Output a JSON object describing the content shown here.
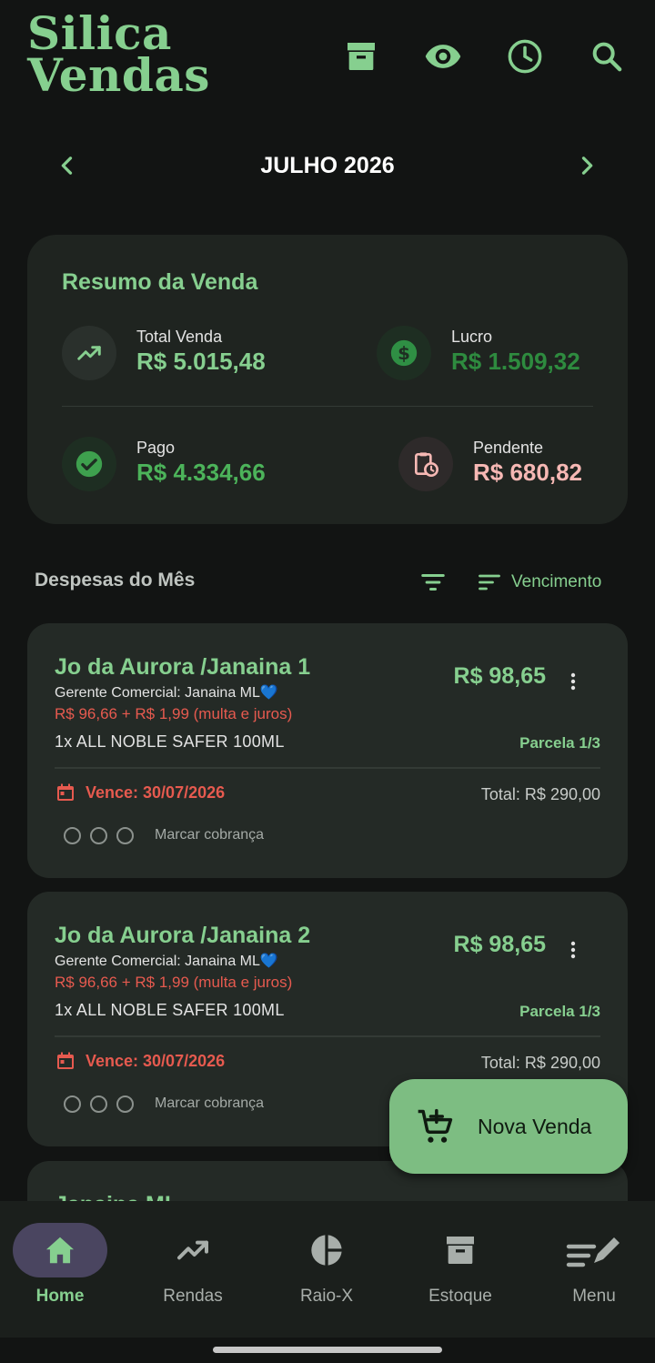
{
  "app": {
    "logo_line1": "Silica",
    "logo_line2": "Vendas"
  },
  "header_icons": [
    "archive-icon",
    "eye-icon",
    "clock-icon",
    "search-icon"
  ],
  "month": {
    "title": "JULHO 2026"
  },
  "summary": {
    "title": "Resumo da Venda",
    "total_venda_label": "Total Venda",
    "total_venda_value": "R$ 5.015,48",
    "lucro_label": "Lucro",
    "lucro_value": "R$ 1.509,32",
    "pago_label": "Pago",
    "pago_value": "R$ 4.334,66",
    "pendente_label": "Pendente",
    "pendente_value": "R$ 680,82"
  },
  "section": {
    "title": "Despesas do Mês",
    "sort_label": "Vencimento"
  },
  "cards": [
    {
      "title": "Jo da Aurora /Janaina 1",
      "sub": "Gerente Comercial: Janaina ML💙",
      "fine": "R$ 96,66 + R$ 1,99 (multa e juros)",
      "item": "1x ALL NOBLE SAFER 100ML",
      "price": "R$ 98,65",
      "parcela": "Parcela 1/3",
      "due": "Vence: 30/07/2026",
      "total": "Total: R$ 290,00",
      "mark": "Marcar cobrança"
    },
    {
      "title": "Jo da Aurora /Janaina 2",
      "sub": "Gerente Comercial: Janaina ML💙",
      "fine": "R$ 96,66 + R$ 1,99 (multa e juros)",
      "item": "1x ALL NOBLE SAFER 100ML",
      "price": "R$ 98,65",
      "parcela": "Parcela 1/3",
      "due": "Vence: 30/07/2026",
      "total": "Total: R$ 290,00",
      "mark": "Marcar cobrança"
    },
    {
      "title": "Janaina ML"
    }
  ],
  "fab": {
    "label": "Nova Venda"
  },
  "nav": [
    {
      "label": "Home",
      "icon": "home-icon"
    },
    {
      "label": "Rendas",
      "icon": "trending-up-icon"
    },
    {
      "label": "Raio-X",
      "icon": "pie-chart-icon"
    },
    {
      "label": "Estoque",
      "icon": "archive-icon"
    },
    {
      "label": "Menu",
      "icon": "edit-note-icon"
    }
  ],
  "colors": {
    "accent": "#86cf8f",
    "danger": "#e65a4f",
    "pending": "#f6b8b4",
    "fab": "#7dbd82",
    "nav_active_pill": "#4a4560"
  }
}
